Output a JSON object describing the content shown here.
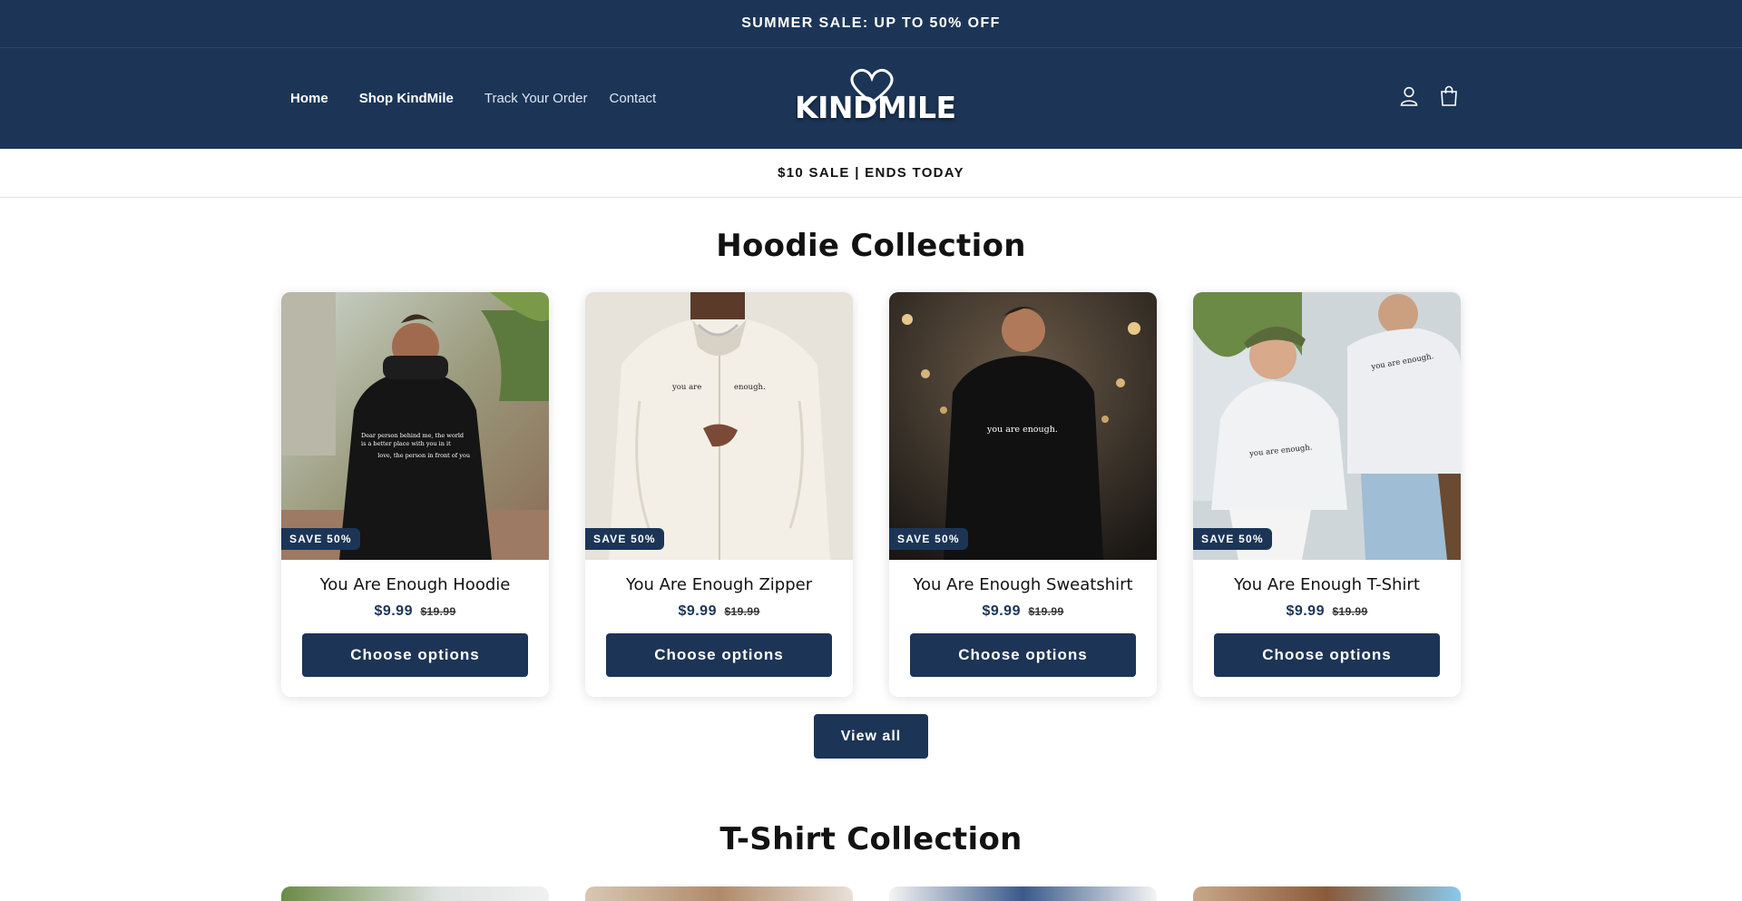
{
  "announcement": "SUMMER SALE: UP TO 50% OFF",
  "nav": {
    "items": [
      {
        "label": "Home"
      },
      {
        "label": "Shop KindMile"
      },
      {
        "label": "Track Your Order"
      },
      {
        "label": "Contact"
      }
    ]
  },
  "logo": {
    "text": "KINDMILE"
  },
  "header_icons": [
    "account-icon",
    "cart-icon"
  ],
  "subbar": "$10 SALE | ENDS TODAY",
  "sections": [
    {
      "title": "Hoodie Collection",
      "products": [
        {
          "badge": "SAVE 50%",
          "title": "You Are Enough Hoodie",
          "price": "$9.99",
          "compare_price": "$19.99",
          "button": "Choose options",
          "print_text": "Dear person behind me, the world is a better place with you in it",
          "print_sign": "love, the person in front of you"
        },
        {
          "badge": "SAVE 50%",
          "title": "You Are Enough Zipper",
          "price": "$9.99",
          "compare_price": "$19.99",
          "button": "Choose options",
          "print_left": "you are",
          "print_right": "enough."
        },
        {
          "badge": "SAVE 50%",
          "title": "You Are Enough Sweatshirt",
          "price": "$9.99",
          "compare_price": "$19.99",
          "button": "Choose options",
          "print_text": "you are enough."
        },
        {
          "badge": "SAVE 50%",
          "title": "You Are Enough T-Shirt",
          "price": "$9.99",
          "compare_price": "$19.99",
          "button": "Choose options",
          "print_text": "you are enough.",
          "print_text_2": "you are enough."
        }
      ],
      "view_all": "View all"
    },
    {
      "title": "T-Shirt Collection"
    }
  ],
  "colors": {
    "brand": "#1c3557",
    "text": "#121212",
    "background": "#ffffff"
  }
}
